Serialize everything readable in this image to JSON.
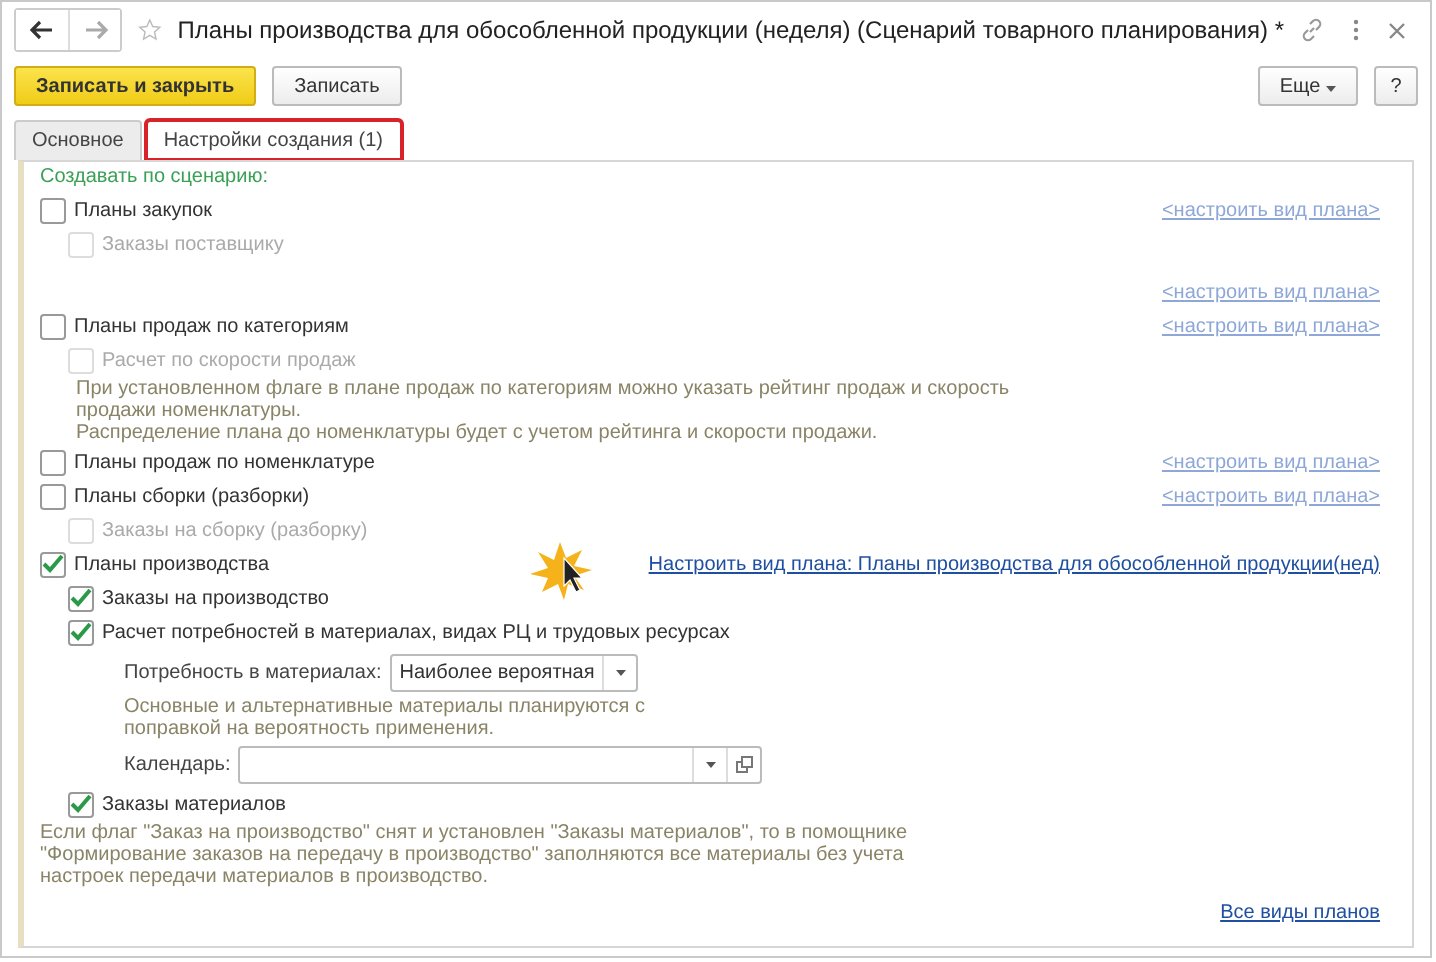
{
  "window": {
    "title": "Планы производства для обособленной продукции (неделя) (Сценарий товарного планирования) *"
  },
  "toolbar": {
    "primary": "Записать и закрыть",
    "secondary": "Записать",
    "more": "Еще",
    "help": "?"
  },
  "tabs": [
    {
      "label": "Основное",
      "selected": false,
      "highlighted": false
    },
    {
      "label": "Настройки создания (1)",
      "selected": true,
      "highlighted": true
    }
  ],
  "section_title": "Создавать по сценарию:",
  "rows": [
    {
      "kind": "checkbox",
      "label": "Планы закупок",
      "checked": false,
      "disabled": false,
      "link": "<настроить вид плана>",
      "children": [
        {
          "kind": "checkbox",
          "label": "Заказы поставщику",
          "checked": false,
          "disabled": true
        }
      ]
    },
    {
      "kind": "link",
      "link": "<настроить вид плана>"
    },
    {
      "kind": "checkbox",
      "label": "Планы продаж по категориям",
      "checked": false,
      "disabled": false,
      "link": "<настроить вид плана>",
      "children": [
        {
          "kind": "checkbox",
          "label": "Расчет по скорости продаж",
          "checked": false,
          "disabled": true
        },
        {
          "kind": "note",
          "lines": [
            "При установленном флаге в плане продаж по категориям можно указать рейтинг продаж и скорость продажи номенклатуры.",
            "Распределение плана до номенклатуры будет с учетом рейтинга и скорости продажи."
          ]
        }
      ]
    },
    {
      "kind": "checkbox",
      "label": "Планы продаж по номенклатуре",
      "checked": false,
      "disabled": false,
      "link": "<настроить вид плана>"
    },
    {
      "kind": "checkbox",
      "label": "Планы сборки (разборки)",
      "checked": false,
      "disabled": false,
      "link": "<настроить вид плана>",
      "children": [
        {
          "kind": "checkbox",
          "label": "Заказы на сборку (разборку)",
          "checked": false,
          "disabled": true
        }
      ]
    },
    {
      "kind": "checkbox",
      "label": "Планы производства",
      "checked": true,
      "disabled": false,
      "link": "Настроить вид плана: Планы производства для обособленной продукции(нед)",
      "children": [
        {
          "kind": "checkbox",
          "label": "Заказы на производство",
          "checked": true,
          "disabled": false
        },
        {
          "kind": "checkbox",
          "label": "Расчет потребностей в материалах, видах РЦ и трудовых ресурсах",
          "checked": true,
          "disabled": false,
          "children": [
            {
              "kind": "select",
              "label": "Потребность в материалах:",
              "value": "Наиболее вероятная"
            },
            {
              "kind": "note",
              "lines": [
                "Основные и альтернативные материалы планируются с поправкой на вероятность применения."
              ]
            },
            {
              "kind": "field",
              "label": "Календарь:"
            }
          ]
        },
        {
          "kind": "checkbox",
          "label": "Заказы материалов",
          "checked": true,
          "disabled": false
        }
      ]
    },
    {
      "kind": "note",
      "lines": [
        "Если флаг \"Заказ на производство\" снят и установлен \"Заказы материалов\", то в помощнике \"Формирование заказов на передачу в производство\" заполняются все материалы без учета настроек передачи материалов в производство."
      ]
    }
  ],
  "footer_link": "Все виды планов"
}
